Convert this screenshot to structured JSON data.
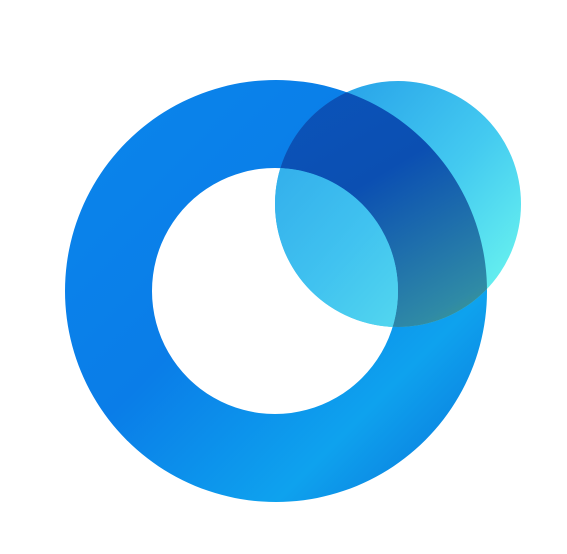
{
  "logo": {
    "icon": "overlapping-ring-and-circle-logo",
    "colors": {
      "ring_primary": "#0a7de8",
      "ring_light": "#0ea2ee",
      "ring_dark": "#0a63c9",
      "circle_cyan": "#5ff0ee",
      "circle_sky": "#2fb7f0",
      "overlap_navy": "#0a4db5",
      "overlap_green": "#6ecb3f",
      "background": "#ffffff"
    }
  }
}
